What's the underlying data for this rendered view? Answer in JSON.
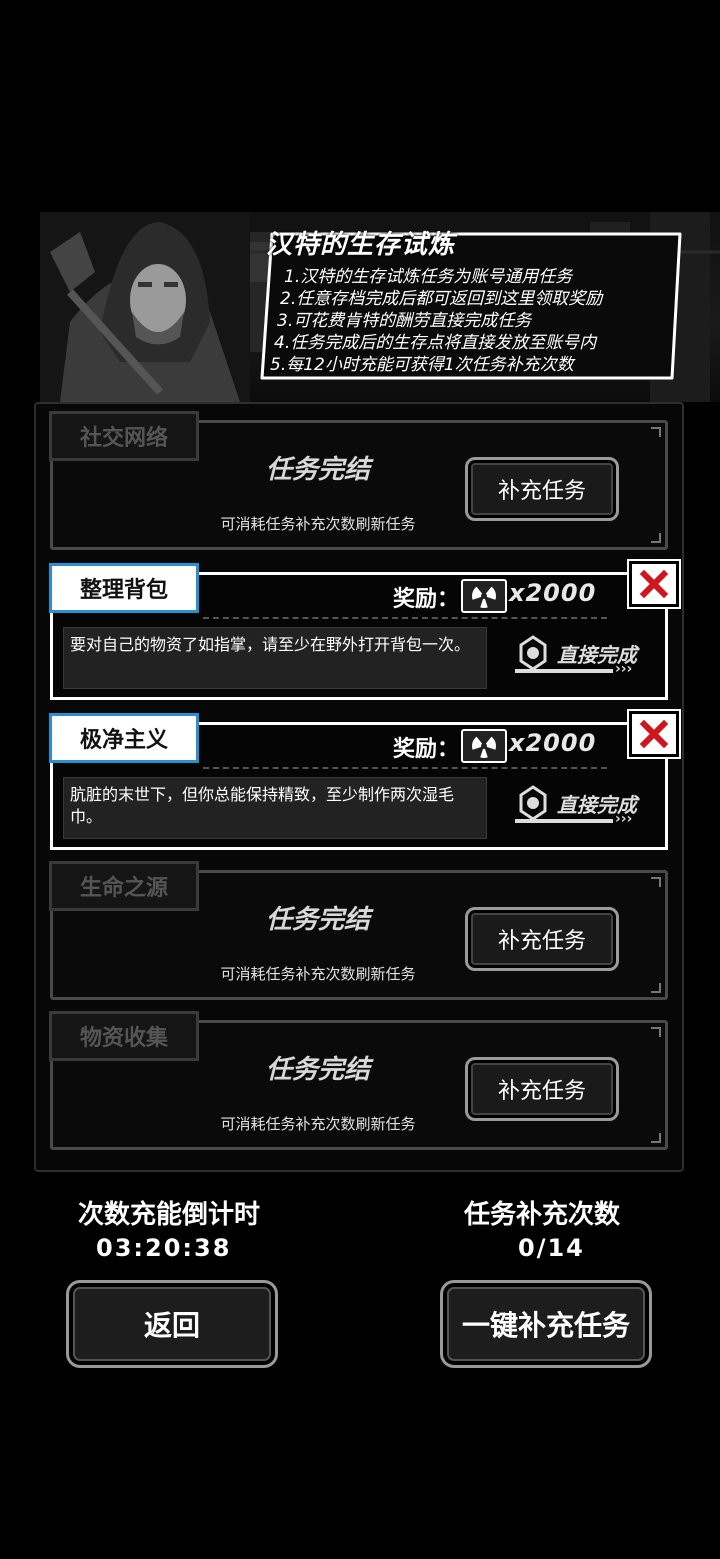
{
  "header": {
    "title": "汉特的生存试炼",
    "rules": [
      "1.汉特的生存试炼任务为账号通用任务",
      "2.任意存档完成后都可返回到这里领取奖励",
      "3.可花费肯特的酬劳直接完成任务",
      "4.任务完成后的生存点将直接发放至账号内",
      "5.每12小时充能可获得1次任务补充次数"
    ]
  },
  "tasks": [
    {
      "name": "社交网络",
      "status": "任务完结",
      "hint": "可消耗任务补充次数刷新任务",
      "button": "补充任务"
    },
    {
      "name": "整理背包",
      "reward_label": "奖励：",
      "reward_qty": "x2000",
      "desc": "要对自己的物资了如指掌，请至少在野外打开背包一次。",
      "finish": "直接完成",
      "arrows": "›››"
    },
    {
      "name": "极净主义",
      "reward_label": "奖励：",
      "reward_qty": "x2000",
      "desc": "肮脏的末世下，但你总能保持精致，至少制作两次湿毛巾。",
      "finish": "直接完成",
      "arrows": "›››"
    },
    {
      "name": "生命之源",
      "status": "任务完结",
      "hint": "可消耗任务补充次数刷新任务",
      "button": "补充任务"
    },
    {
      "name": "物资收集",
      "status": "任务完结",
      "hint": "可消耗任务补充次数刷新任务",
      "button": "补充任务"
    }
  ],
  "footer": {
    "countdown_label": "次数充能倒计时",
    "countdown_value": "03:20:38",
    "refill_label": "任务补充次数",
    "refill_value": "0/14",
    "back_button": "返回",
    "refill_all_button": "一键补充任务"
  },
  "colors": {
    "accent_blue": "#2a8fd0",
    "close_red": "#d0161c"
  }
}
